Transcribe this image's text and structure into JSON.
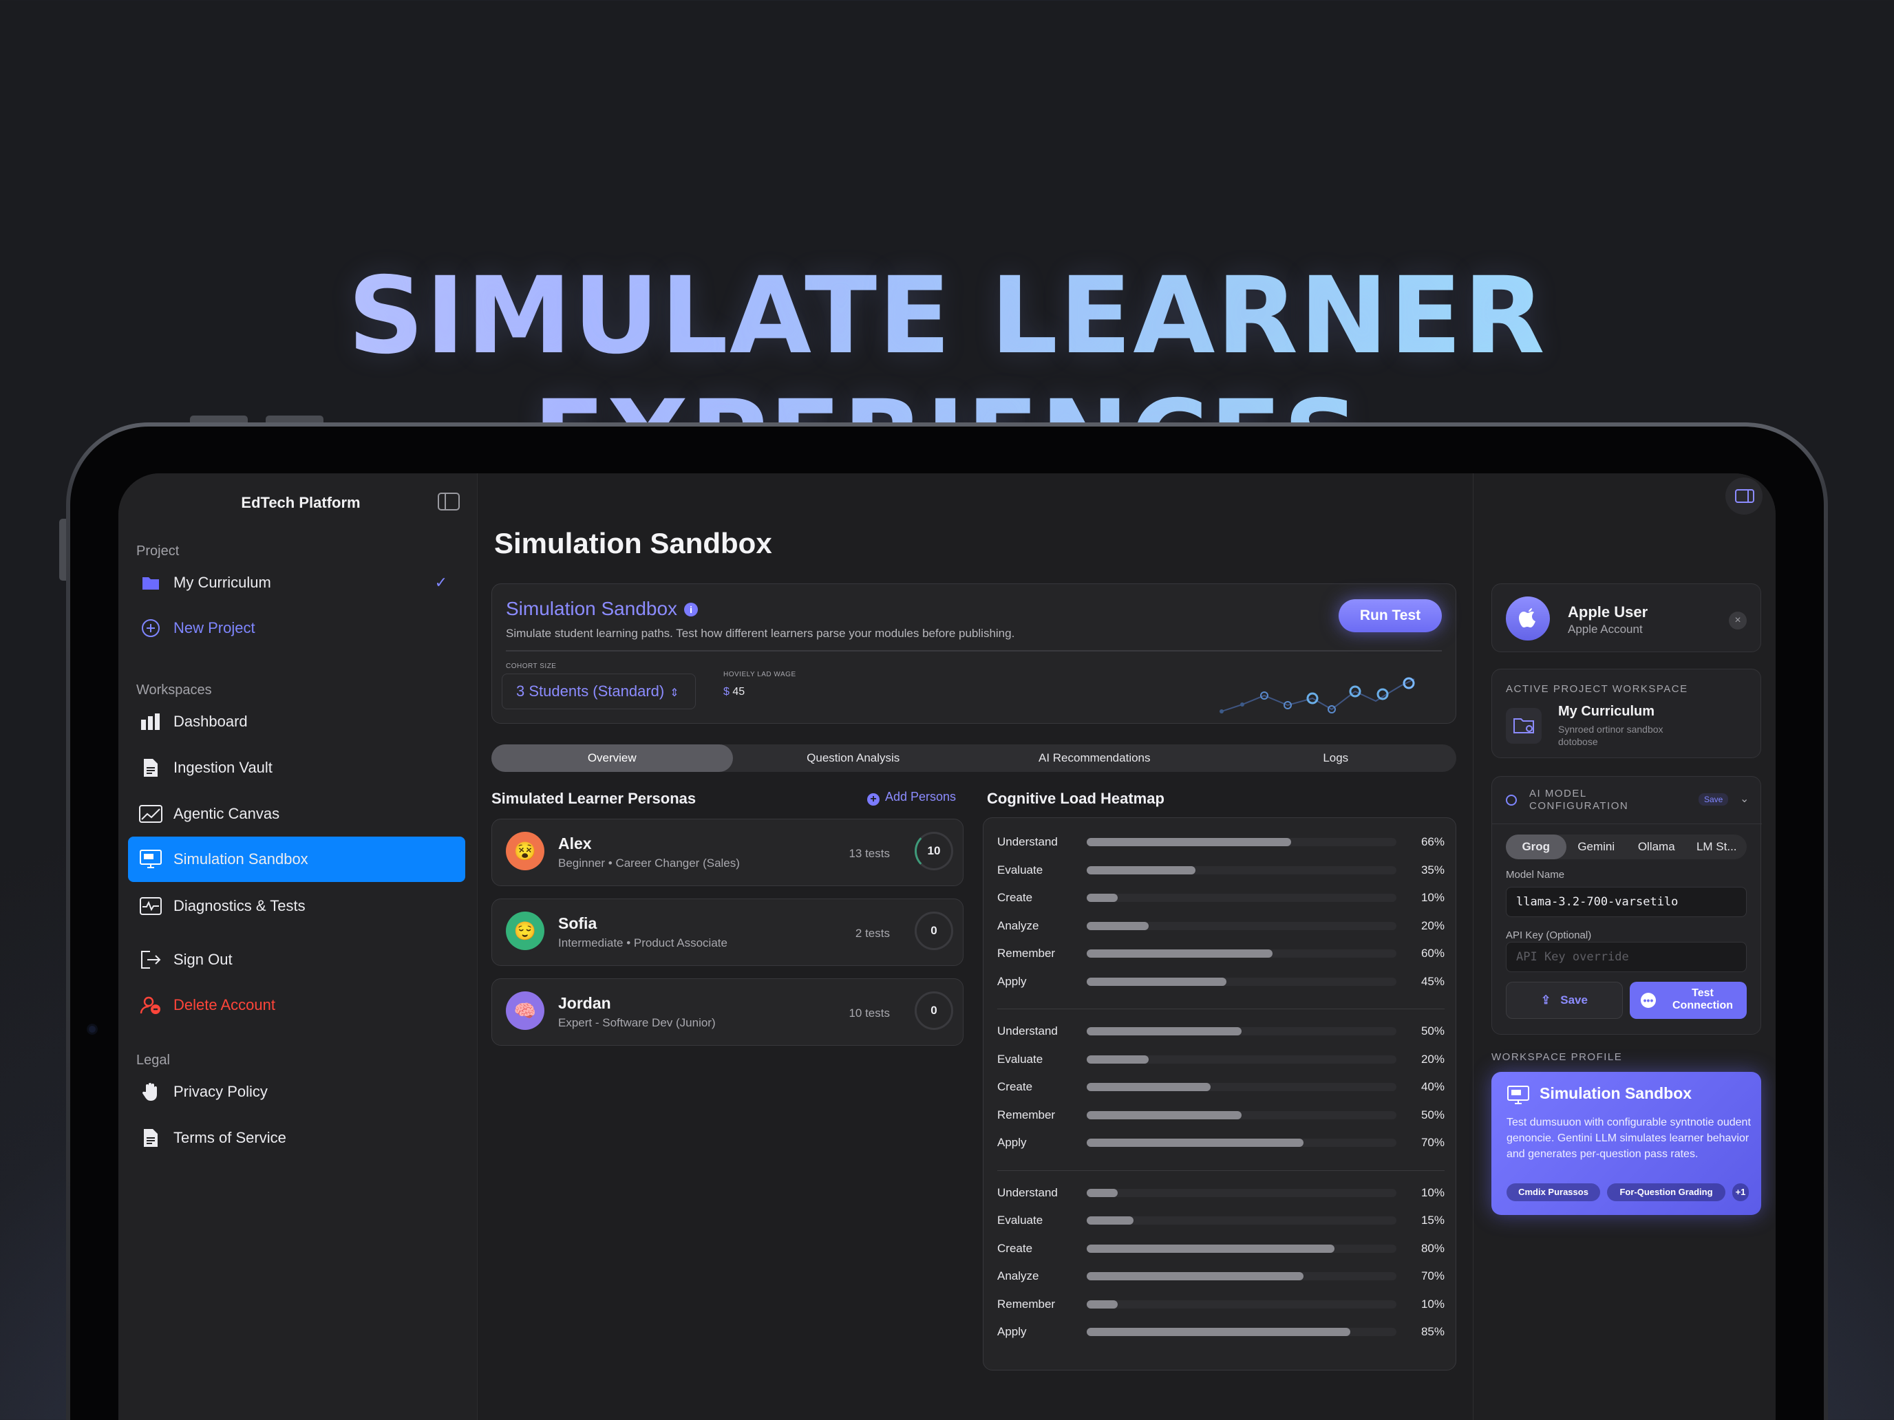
{
  "hero": {
    "title": "SIMULATE LEARNER EXPERIENCES"
  },
  "sidebar": {
    "app_title": "EdTech Platform",
    "project_section": "Project",
    "project_items": [
      {
        "label": "My Curriculum",
        "icon": "folder-icon"
      },
      {
        "label": "New Project",
        "icon": "plus-circle-icon"
      }
    ],
    "workspaces_section": "Workspaces",
    "workspace_items": [
      {
        "label": "Dashboard",
        "icon": "bar-chart-icon"
      },
      {
        "label": "Ingestion Vault",
        "icon": "document-icon"
      },
      {
        "label": "Agentic Canvas",
        "icon": "line-chart-icon"
      },
      {
        "label": "Simulation Sandbox",
        "icon": "monitor-icon",
        "active": true
      },
      {
        "label": "Diagnostics & Tests",
        "icon": "pulse-icon"
      }
    ],
    "account_items": [
      {
        "label": "Sign Out",
        "icon": "sign-out-icon"
      },
      {
        "label": "Delete Account",
        "icon": "delete-account-icon"
      }
    ],
    "legal_section": "Legal",
    "legal_items": [
      {
        "label": "Privacy Policy",
        "icon": "hand-icon"
      },
      {
        "label": "Terms of Service",
        "icon": "document-icon"
      }
    ]
  },
  "main": {
    "page_title": "Simulation Sandbox",
    "header": {
      "title": "Simulation Sandbox",
      "subtitle": "Simulate student learning paths. Test how different learners parse your modules before publishing.",
      "run_button": "Run Test",
      "cohort_label": "COHORT SIZE",
      "cohort_value": "3 Students (Standard)",
      "wage_label": "HOVIELY LAD WAGE",
      "wage_currency": "$",
      "wage_value": "45"
    },
    "tabs": [
      "Overview",
      "Question Analysis",
      "AI Recommendations",
      "Logs"
    ],
    "active_tab": "Overview",
    "personas_title": "Simulated Learner Personas",
    "add_personas": "Add Persons",
    "personas": [
      {
        "name": "Alex",
        "desc": "Beginner • Career Changer (Sales)",
        "tests": "13 tests",
        "count": "10",
        "emoji": "😵",
        "color": "#f0744a"
      },
      {
        "name": "Sofia",
        "desc": "Intermediate • Product Associate",
        "tests": "2 tests",
        "count": "0",
        "emoji": "😌",
        "color": "#34b27a"
      },
      {
        "name": "Jordan",
        "desc": "Expert - Software Dev (Junior)",
        "tests": "10 tests",
        "count": "0",
        "emoji": "🧠",
        "color": "#8e74e8"
      }
    ],
    "heatmap_title": "Cognitive Load Heatmap",
    "heatmap_groups": [
      [
        {
          "label": "Understand",
          "value": 66
        },
        {
          "label": "Evaluate",
          "value": 35
        },
        {
          "label": "Create",
          "value": 10
        },
        {
          "label": "Analyze",
          "value": 20
        },
        {
          "label": "Remember",
          "value": 60
        },
        {
          "label": "Apply",
          "value": 45
        }
      ],
      [
        {
          "label": "Understand",
          "value": 50
        },
        {
          "label": "Evaluate",
          "value": 20
        },
        {
          "label": "Create",
          "value": 40
        },
        {
          "label": "Remember",
          "value": 50
        },
        {
          "label": "Apply",
          "value": 70
        }
      ],
      [
        {
          "label": "Understand",
          "value": 10
        },
        {
          "label": "Evaluate",
          "value": 15
        },
        {
          "label": "Create",
          "value": 80
        },
        {
          "label": "Analyze",
          "value": 70
        },
        {
          "label": "Remember",
          "value": 10
        },
        {
          "label": "Apply",
          "value": 85
        }
      ]
    ]
  },
  "right_panel": {
    "user": {
      "name": "Apple User",
      "sub": "Apple Account"
    },
    "workspace_caption": "ACTIVE PROJECT WORKSPACE",
    "workspace_name": "My Curriculum",
    "workspace_sub": "Synroed ortinor sandbox dotobose",
    "ai_caption": "AI MODEL CONFIGURATION",
    "ai_badge": "Save",
    "providers": [
      "Grog",
      "Gemini",
      "Ollama",
      "LM St..."
    ],
    "active_provider": "Grog",
    "model_label": "Model Name",
    "model_value": "llama-3.2-700-varsetilo",
    "api_label": "API Key (Optional)",
    "api_placeholder": "API Key override",
    "save_button": "Save",
    "test_button": "Test Connection",
    "profile_caption": "WORKSPACE PROFILE",
    "profile_title": "Simulation Sandbox",
    "profile_desc": "Test dumsuuon with configurable syntnotie oudent genoncie. Gentini LLM simulates learner behavior and generates per-question pass rates.",
    "chips": [
      "Cmdix Purassos",
      "For-Question Grading",
      "+1"
    ]
  },
  "colors": {
    "accent": "#7f86ff",
    "active_nav": "#0a84ff",
    "danger": "#ff453a"
  }
}
